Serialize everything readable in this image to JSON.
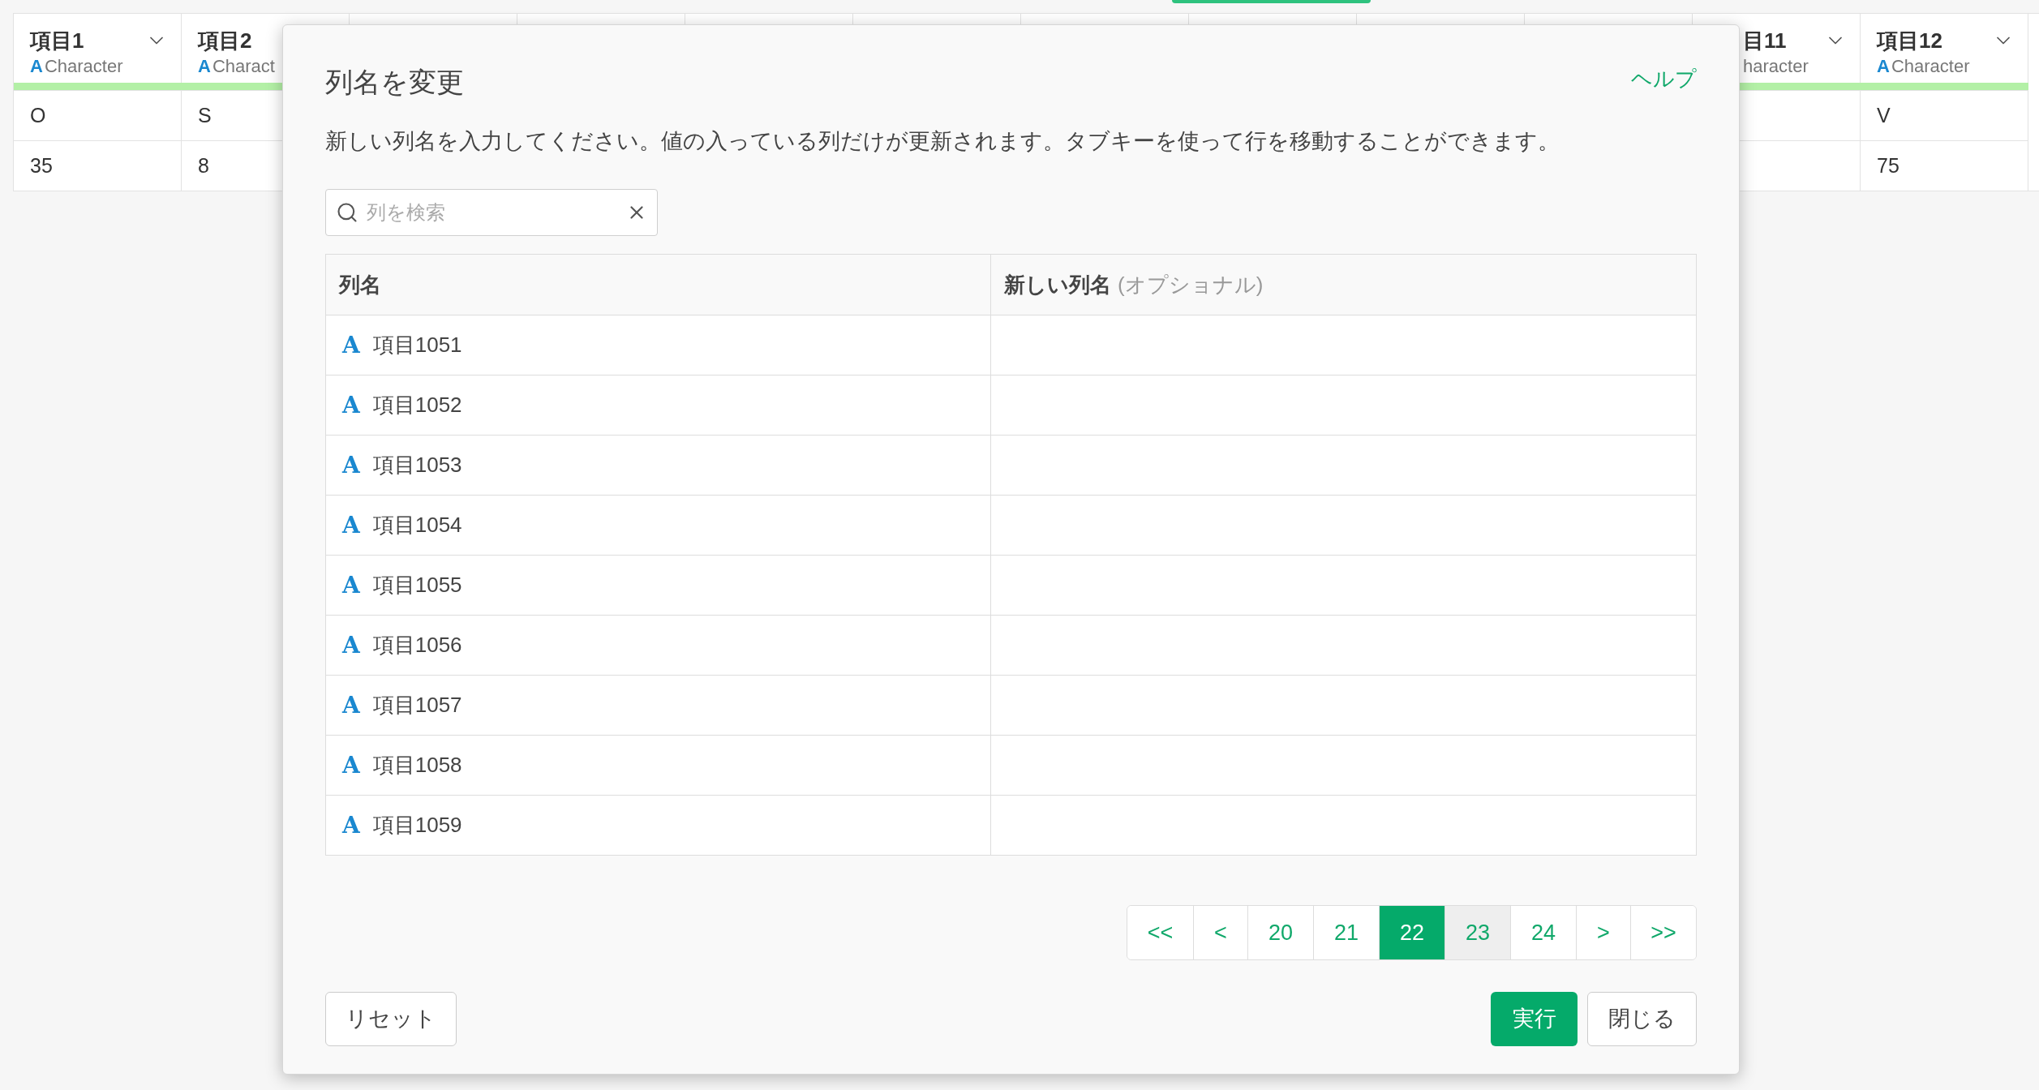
{
  "grid": {
    "left_columns": [
      {
        "name": "項目1",
        "type_mark": "A",
        "type": "Character",
        "menu": true,
        "cells": [
          "O",
          "35"
        ]
      },
      {
        "name": "項目2",
        "type_mark": "A",
        "type": "Charact",
        "menu": false,
        "cells": [
          "S",
          "8"
        ]
      }
    ],
    "right_columns": [
      {
        "name": "目11",
        "type": "haracter",
        "menu": true
      },
      {
        "name": "項目12",
        "type_mark": "A",
        "type": "Character",
        "menu": true,
        "cells": [
          "V",
          "75"
        ]
      }
    ]
  },
  "dialog": {
    "title": "列名を変更",
    "help_link": "ヘルプ",
    "description": "新しい列名を入力してください。値の入っている列だけが更新されます。タブキーを使って行を移動することができます。",
    "search": {
      "placeholder": "列を検索"
    },
    "table": {
      "columns": [
        {
          "label": "列名"
        },
        {
          "label": "新しい列名",
          "note": "(オプショナル)"
        }
      ],
      "rows": [
        {
          "type_mark": "A",
          "name": "項目1051"
        },
        {
          "type_mark": "A",
          "name": "項目1052"
        },
        {
          "type_mark": "A",
          "name": "項目1053"
        },
        {
          "type_mark": "A",
          "name": "項目1054"
        },
        {
          "type_mark": "A",
          "name": "項目1055"
        },
        {
          "type_mark": "A",
          "name": "項目1056"
        },
        {
          "type_mark": "A",
          "name": "項目1057"
        },
        {
          "type_mark": "A",
          "name": "項目1058"
        },
        {
          "type_mark": "A",
          "name": "項目1059"
        }
      ]
    },
    "pagination": [
      {
        "label": "<<",
        "selected": false,
        "hovered": false
      },
      {
        "label": "<",
        "selected": false,
        "hovered": false
      },
      {
        "label": "20",
        "selected": false,
        "hovered": false
      },
      {
        "label": "21",
        "selected": false,
        "hovered": false
      },
      {
        "label": "22",
        "selected": true,
        "hovered": false
      },
      {
        "label": "23",
        "selected": false,
        "hovered": true
      },
      {
        "label": "24",
        "selected": false,
        "hovered": false
      },
      {
        "label": ">",
        "selected": false,
        "hovered": false
      },
      {
        "label": ">>",
        "selected": false,
        "hovered": false
      }
    ],
    "buttons": {
      "reset": "リセット",
      "run": "実行",
      "close": "閉じる"
    }
  }
}
